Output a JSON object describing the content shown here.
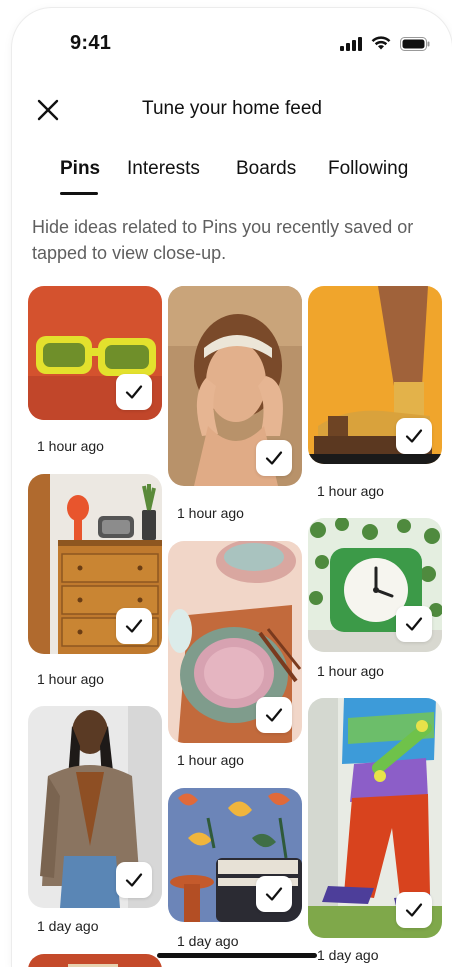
{
  "status_bar": {
    "time": "9:41",
    "icons": [
      "signal-icon",
      "wifi-icon",
      "battery-icon"
    ]
  },
  "header": {
    "title": "Tune your home feed",
    "close_icon": "close-icon"
  },
  "tabs": [
    {
      "label": "Pins",
      "active": true
    },
    {
      "label": "Interests",
      "active": false
    },
    {
      "label": "Boards",
      "active": false
    },
    {
      "label": "Following",
      "active": false
    }
  ],
  "description": "Hide ideas related to Pins you recently saved or tapped to view close-up.",
  "pins": [
    {
      "subject": "yellow sunglasses",
      "time": "1 hour ago",
      "checked": true
    },
    {
      "subject": "woman with headband",
      "time": "1 hour ago",
      "checked": true
    },
    {
      "subject": "socks and sandals",
      "time": "1 hour ago",
      "checked": true
    },
    {
      "subject": "wooden dresser",
      "time": "1 hour ago",
      "checked": true
    },
    {
      "subject": "plates and cutlery",
      "time": "1 hour ago",
      "checked": true
    },
    {
      "subject": "green alarm clock",
      "time": "1 hour ago",
      "checked": true
    },
    {
      "subject": "woman in plaid blazer",
      "time": "1 day ago",
      "checked": true
    },
    {
      "subject": "patterned wallpaper chair",
      "time": "1 day ago",
      "checked": true
    },
    {
      "subject": "skateboarder",
      "time": "1 day ago",
      "checked": true
    }
  ],
  "colors": {
    "text": "#111111",
    "muted": "#5f5f5f",
    "check_bg": "#ffffff"
  }
}
